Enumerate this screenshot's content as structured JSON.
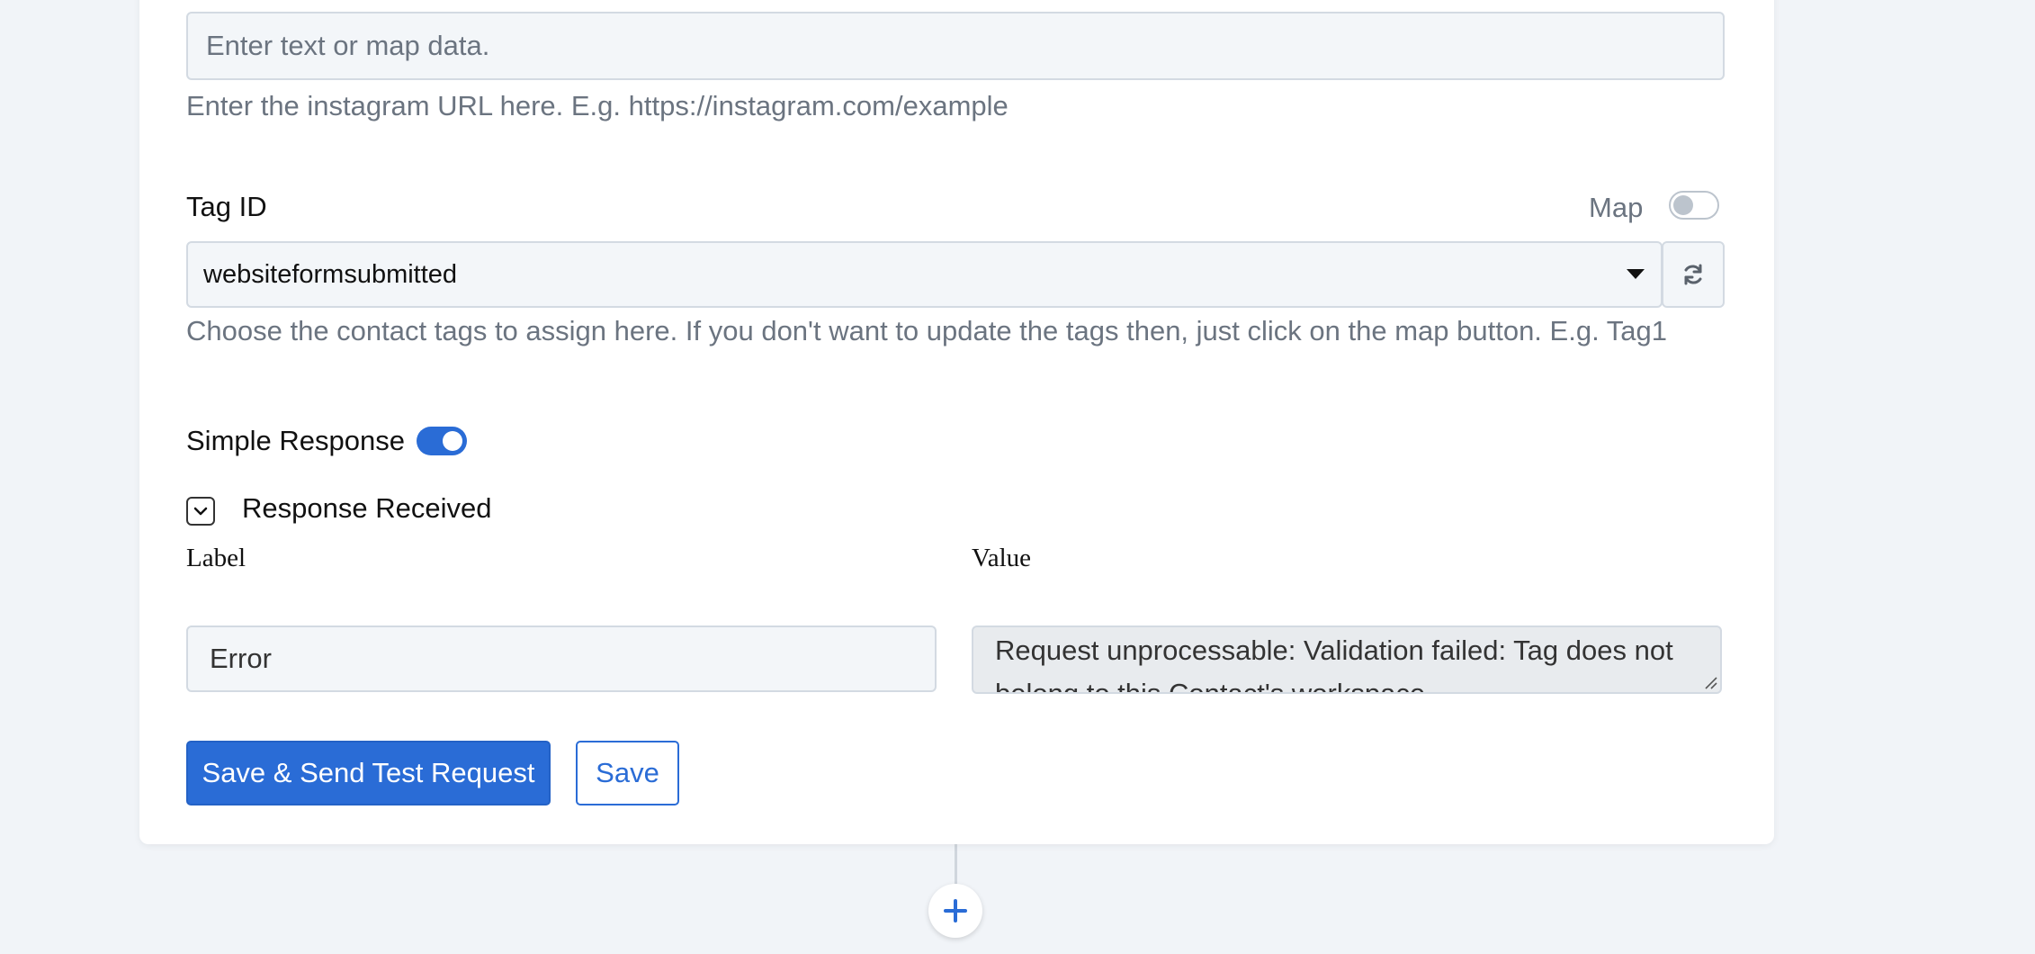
{
  "instagram_field": {
    "placeholder": "Enter text or map data.",
    "help": "Enter the instagram URL here. E.g. https://instagram.com/example"
  },
  "tag_field": {
    "label": "Tag ID",
    "map_label": "Map",
    "map_enabled": false,
    "selected_value": "websiteformsubmitted",
    "help": "Choose the contact tags to assign here. If you don't want to update the tags then, just click on the map button. E.g. Tag1"
  },
  "simple_response": {
    "label": "Simple Response",
    "enabled": true
  },
  "response_section": {
    "title": "Response Received",
    "expanded": true,
    "label_header": "Label",
    "value_header": "Value",
    "label_value": "Error",
    "value_text": "Request unprocessable: Validation failed: Tag does not belong to this Contact's workspace"
  },
  "actions": {
    "save_test_label": "Save & Send Test Request",
    "save_label": "Save"
  },
  "colors": {
    "accent": "#2a6cd6",
    "page_background": "#f1f4f8",
    "help_text": "#6b7480"
  },
  "icons": {
    "dropdown": "caret-down-icon",
    "refresh": "refresh-icon",
    "collapse": "chevron-down-icon",
    "add_step": "plus-icon"
  }
}
